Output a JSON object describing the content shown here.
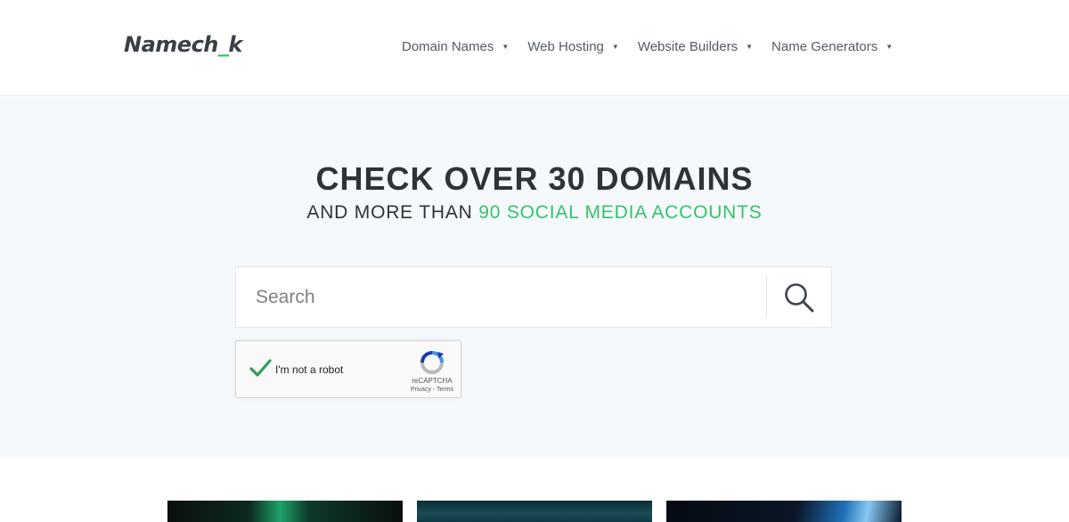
{
  "header": {
    "logo": {
      "prefix": "Namech",
      "underscore": "_",
      "suffix": "k"
    },
    "nav": [
      {
        "label": "Domain Names"
      },
      {
        "label": "Web Hosting"
      },
      {
        "label": "Website Builders"
      },
      {
        "label": "Name Generators"
      }
    ],
    "caret_glyph": "▼"
  },
  "hero": {
    "headline_light": "CHECK OVER ",
    "headline_bold": "30 DOMAINS",
    "subline_plain": "AND MORE THAN ",
    "subline_accent": "90 SOCIAL MEDIA ACCOUNTS",
    "accent_color": "#35c36a"
  },
  "search": {
    "placeholder": "Search",
    "value": "",
    "button_icon": "search-icon"
  },
  "captcha": {
    "label": "I'm not a robot",
    "checked": true,
    "brand": "reCAPTCHA",
    "links": "Privacy - Terms"
  },
  "cards": [
    {
      "image": "green-glowing-sphere"
    },
    {
      "image": "teal-abstract"
    },
    {
      "image": "blue-light-streak"
    }
  ]
}
